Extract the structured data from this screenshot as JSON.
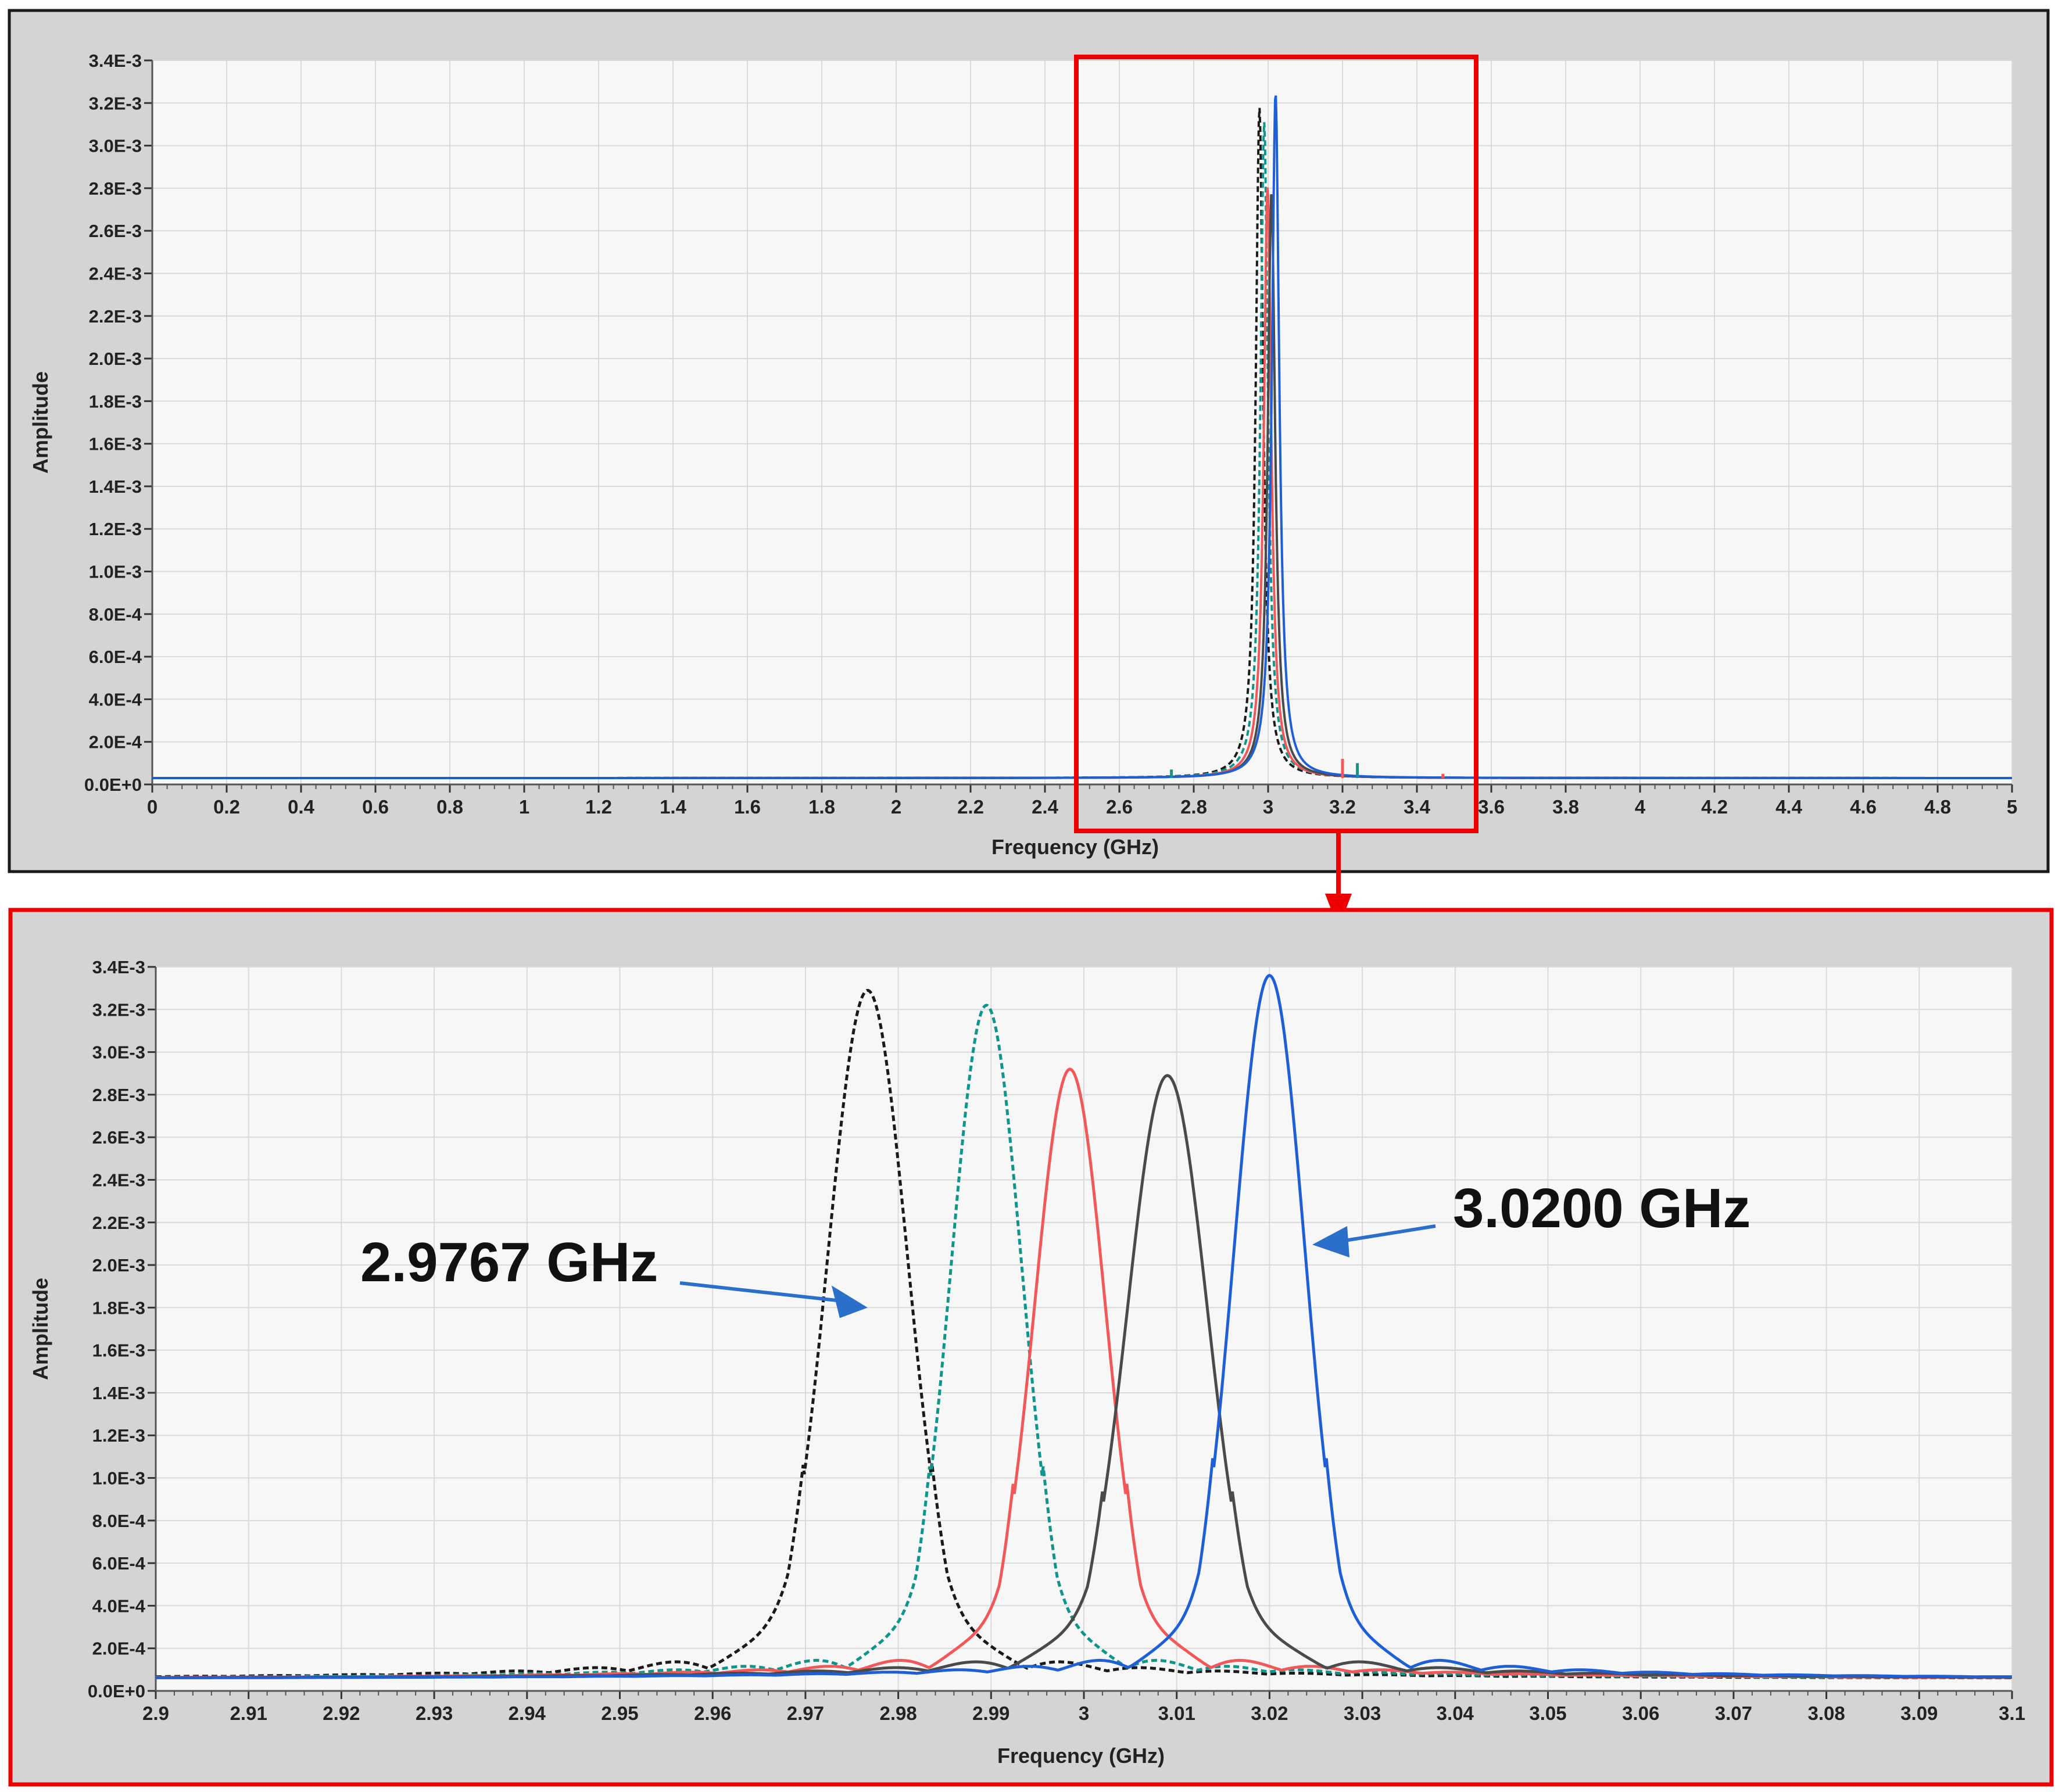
{
  "colors": {
    "panel_bg": "#d4d4d4",
    "plot_bg": "#f7f7f7",
    "grid": "#dadada",
    "highlight": "#ee0000",
    "annotation_arrow": "#2a6fc9",
    "black_series": "#1a1a1a",
    "teal_series": "#10958a",
    "red_series": "#f0585a",
    "grey_series": "#4a4a4a",
    "blue_series": "#1f5fd6"
  },
  "chart_data": [
    {
      "type": "line",
      "xlabel": "Frequency (GHz)",
      "ylabel": "Amplitude",
      "xlim": [
        0,
        5
      ],
      "ylim": [
        0,
        0.0034
      ],
      "grid": true,
      "x_ticks": [
        "0",
        "0.2",
        "0.4",
        "0.6",
        "0.8",
        "1",
        "1.2",
        "1.4",
        "1.6",
        "1.8",
        "2",
        "2.2",
        "2.4",
        "2.6",
        "2.8",
        "3",
        "3.2",
        "3.4",
        "3.6",
        "3.8",
        "4",
        "4.2",
        "4.4",
        "4.6",
        "4.8",
        "5"
      ],
      "y_ticks": [
        "0.0E+0",
        "2.0E-4",
        "4.0E-4",
        "6.0E-4",
        "8.0E-4",
        "1.0E-3",
        "1.2E-3",
        "1.4E-3",
        "1.6E-3",
        "1.8E-3",
        "2.0E-3",
        "2.2E-3",
        "2.4E-3",
        "2.6E-3",
        "2.8E-3",
        "3.0E-3",
        "3.2E-3",
        "3.4E-3"
      ],
      "highlight_range_x": [
        2.5,
        3.55
      ],
      "series": [
        {
          "color": "#1a1a1a",
          "dash": "dashed",
          "peak_x": 2.9767,
          "peak_y": 0.00315
        },
        {
          "color": "#10958a",
          "dash": "dashed",
          "peak_x": 2.9895,
          "peak_y": 0.00308
        },
        {
          "color": "#f0585a",
          "dash": "solid",
          "peak_x": 2.9985,
          "peak_y": 0.00278
        },
        {
          "color": "#4a4a4a",
          "dash": "solid",
          "peak_x": 3.009,
          "peak_y": 0.00275
        },
        {
          "color": "#1f5fd6",
          "dash": "solid",
          "peak_x": 3.02,
          "peak_y": 0.00322
        }
      ]
    },
    {
      "type": "line",
      "xlabel": "Frequency (GHz)",
      "ylabel": "Amplitude",
      "xlim": [
        2.9,
        3.1
      ],
      "ylim": [
        0,
        0.0034
      ],
      "grid": true,
      "x_ticks": [
        "2.9",
        "2.91",
        "2.92",
        "2.93",
        "2.94",
        "2.95",
        "2.96",
        "2.97",
        "2.98",
        "2.99",
        "3",
        "3.01",
        "3.02",
        "3.03",
        "3.04",
        "3.05",
        "3.06",
        "3.07",
        "3.08",
        "3.09",
        "3.1"
      ],
      "y_ticks": [
        "0.0E+0",
        "2.0E-4",
        "4.0E-4",
        "6.0E-4",
        "8.0E-4",
        "1.0E-3",
        "1.2E-3",
        "1.4E-3",
        "1.6E-3",
        "1.8E-3",
        "2.0E-3",
        "2.2E-3",
        "2.4E-3",
        "2.6E-3",
        "2.8E-3",
        "3.0E-3",
        "3.2E-3",
        "3.4E-3"
      ],
      "annotations": [
        {
          "text": "2.9767 GHz",
          "points_to_x": 2.9767,
          "points_to_y": 0.0018
        },
        {
          "text": "3.0200 GHz",
          "points_to_x": 3.0085,
          "points_to_y": 0.0021
        }
      ],
      "series": [
        {
          "color": "#1a1a1a",
          "dash": "dashed",
          "peak_x": 2.9767,
          "peak_y": 0.00315,
          "width": 0.0043
        },
        {
          "color": "#10958a",
          "dash": "dashed",
          "peak_x": 2.9895,
          "peak_y": 0.00308,
          "width": 0.0038
        },
        {
          "color": "#f0585a",
          "dash": "solid",
          "peak_x": 2.9985,
          "peak_y": 0.00278,
          "width": 0.0038
        },
        {
          "color": "#4a4a4a",
          "dash": "solid",
          "peak_x": 3.009,
          "peak_y": 0.00275,
          "width": 0.0043
        },
        {
          "color": "#1f5fd6",
          "dash": "solid",
          "peak_x": 3.02,
          "peak_y": 0.00322,
          "width": 0.0038
        }
      ]
    }
  ]
}
